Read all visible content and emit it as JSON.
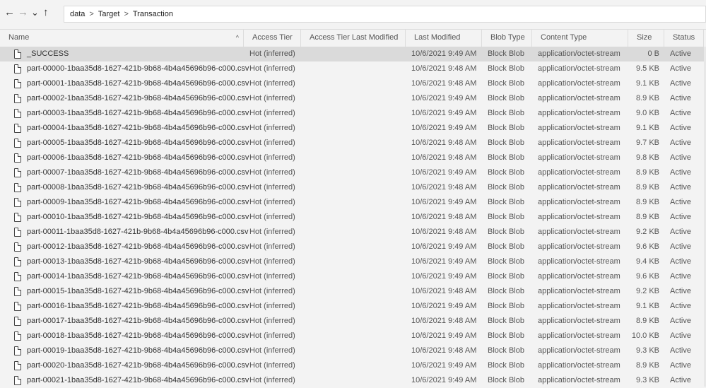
{
  "nav": {
    "back": "←",
    "forward": "→",
    "recent": "⌄",
    "up": "↑"
  },
  "breadcrumb": [
    "data",
    "Target",
    "Transaction"
  ],
  "columns": [
    "Name",
    "Access Tier",
    "Access Tier Last Modified",
    "Last Modified",
    "Blob Type",
    "Content Type",
    "Size",
    "Status"
  ],
  "sort_indicator": "^",
  "rows": [
    {
      "name": "_SUCCESS",
      "tier": "Hot (inferred)",
      "tlm": "",
      "modified": "10/6/2021 9:49 AM",
      "type": "Block Blob",
      "content": "application/octet-stream",
      "size": "0 B",
      "status": "Active"
    },
    {
      "name": "part-00000-1baa35d8-1627-421b-9b68-4b4a45696b96-c000.csv",
      "tier": "Hot (inferred)",
      "tlm": "",
      "modified": "10/6/2021 9:48 AM",
      "type": "Block Blob",
      "content": "application/octet-stream",
      "size": "9.5 KB",
      "status": "Active"
    },
    {
      "name": "part-00001-1baa35d8-1627-421b-9b68-4b4a45696b96-c000.csv",
      "tier": "Hot (inferred)",
      "tlm": "",
      "modified": "10/6/2021 9:48 AM",
      "type": "Block Blob",
      "content": "application/octet-stream",
      "size": "9.1 KB",
      "status": "Active"
    },
    {
      "name": "part-00002-1baa35d8-1627-421b-9b68-4b4a45696b96-c000.csv",
      "tier": "Hot (inferred)",
      "tlm": "",
      "modified": "10/6/2021 9:49 AM",
      "type": "Block Blob",
      "content": "application/octet-stream",
      "size": "8.9 KB",
      "status": "Active"
    },
    {
      "name": "part-00003-1baa35d8-1627-421b-9b68-4b4a45696b96-c000.csv",
      "tier": "Hot (inferred)",
      "tlm": "",
      "modified": "10/6/2021 9:49 AM",
      "type": "Block Blob",
      "content": "application/octet-stream",
      "size": "9.0 KB",
      "status": "Active"
    },
    {
      "name": "part-00004-1baa35d8-1627-421b-9b68-4b4a45696b96-c000.csv",
      "tier": "Hot (inferred)",
      "tlm": "",
      "modified": "10/6/2021 9:49 AM",
      "type": "Block Blob",
      "content": "application/octet-stream",
      "size": "9.1 KB",
      "status": "Active"
    },
    {
      "name": "part-00005-1baa35d8-1627-421b-9b68-4b4a45696b96-c000.csv",
      "tier": "Hot (inferred)",
      "tlm": "",
      "modified": "10/6/2021 9:48 AM",
      "type": "Block Blob",
      "content": "application/octet-stream",
      "size": "9.7 KB",
      "status": "Active"
    },
    {
      "name": "part-00006-1baa35d8-1627-421b-9b68-4b4a45696b96-c000.csv",
      "tier": "Hot (inferred)",
      "tlm": "",
      "modified": "10/6/2021 9:48 AM",
      "type": "Block Blob",
      "content": "application/octet-stream",
      "size": "9.8 KB",
      "status": "Active"
    },
    {
      "name": "part-00007-1baa35d8-1627-421b-9b68-4b4a45696b96-c000.csv",
      "tier": "Hot (inferred)",
      "tlm": "",
      "modified": "10/6/2021 9:49 AM",
      "type": "Block Blob",
      "content": "application/octet-stream",
      "size": "8.9 KB",
      "status": "Active"
    },
    {
      "name": "part-00008-1baa35d8-1627-421b-9b68-4b4a45696b96-c000.csv",
      "tier": "Hot (inferred)",
      "tlm": "",
      "modified": "10/6/2021 9:48 AM",
      "type": "Block Blob",
      "content": "application/octet-stream",
      "size": "8.9 KB",
      "status": "Active"
    },
    {
      "name": "part-00009-1baa35d8-1627-421b-9b68-4b4a45696b96-c000.csv",
      "tier": "Hot (inferred)",
      "tlm": "",
      "modified": "10/6/2021 9:49 AM",
      "type": "Block Blob",
      "content": "application/octet-stream",
      "size": "8.9 KB",
      "status": "Active"
    },
    {
      "name": "part-00010-1baa35d8-1627-421b-9b68-4b4a45696b96-c000.csv",
      "tier": "Hot (inferred)",
      "tlm": "",
      "modified": "10/6/2021 9:48 AM",
      "type": "Block Blob",
      "content": "application/octet-stream",
      "size": "8.9 KB",
      "status": "Active"
    },
    {
      "name": "part-00011-1baa35d8-1627-421b-9b68-4b4a45696b96-c000.csv",
      "tier": "Hot (inferred)",
      "tlm": "",
      "modified": "10/6/2021 9:48 AM",
      "type": "Block Blob",
      "content": "application/octet-stream",
      "size": "9.2 KB",
      "status": "Active"
    },
    {
      "name": "part-00012-1baa35d8-1627-421b-9b68-4b4a45696b96-c000.csv",
      "tier": "Hot (inferred)",
      "tlm": "",
      "modified": "10/6/2021 9:49 AM",
      "type": "Block Blob",
      "content": "application/octet-stream",
      "size": "9.6 KB",
      "status": "Active"
    },
    {
      "name": "part-00013-1baa35d8-1627-421b-9b68-4b4a45696b96-c000.csv",
      "tier": "Hot (inferred)",
      "tlm": "",
      "modified": "10/6/2021 9:49 AM",
      "type": "Block Blob",
      "content": "application/octet-stream",
      "size": "9.4 KB",
      "status": "Active"
    },
    {
      "name": "part-00014-1baa35d8-1627-421b-9b68-4b4a45696b96-c000.csv",
      "tier": "Hot (inferred)",
      "tlm": "",
      "modified": "10/6/2021 9:49 AM",
      "type": "Block Blob",
      "content": "application/octet-stream",
      "size": "9.6 KB",
      "status": "Active"
    },
    {
      "name": "part-00015-1baa35d8-1627-421b-9b68-4b4a45696b96-c000.csv",
      "tier": "Hot (inferred)",
      "tlm": "",
      "modified": "10/6/2021 9:48 AM",
      "type": "Block Blob",
      "content": "application/octet-stream",
      "size": "9.2 KB",
      "status": "Active"
    },
    {
      "name": "part-00016-1baa35d8-1627-421b-9b68-4b4a45696b96-c000.csv",
      "tier": "Hot (inferred)",
      "tlm": "",
      "modified": "10/6/2021 9:49 AM",
      "type": "Block Blob",
      "content": "application/octet-stream",
      "size": "9.1 KB",
      "status": "Active"
    },
    {
      "name": "part-00017-1baa35d8-1627-421b-9b68-4b4a45696b96-c000.csv",
      "tier": "Hot (inferred)",
      "tlm": "",
      "modified": "10/6/2021 9:48 AM",
      "type": "Block Blob",
      "content": "application/octet-stream",
      "size": "8.9 KB",
      "status": "Active"
    },
    {
      "name": "part-00018-1baa35d8-1627-421b-9b68-4b4a45696b96-c000.csv",
      "tier": "Hot (inferred)",
      "tlm": "",
      "modified": "10/6/2021 9:49 AM",
      "type": "Block Blob",
      "content": "application/octet-stream",
      "size": "10.0 KB",
      "status": "Active"
    },
    {
      "name": "part-00019-1baa35d8-1627-421b-9b68-4b4a45696b96-c000.csv",
      "tier": "Hot (inferred)",
      "tlm": "",
      "modified": "10/6/2021 9:48 AM",
      "type": "Block Blob",
      "content": "application/octet-stream",
      "size": "9.3 KB",
      "status": "Active"
    },
    {
      "name": "part-00020-1baa35d8-1627-421b-9b68-4b4a45696b96-c000.csv",
      "tier": "Hot (inferred)",
      "tlm": "",
      "modified": "10/6/2021 9:49 AM",
      "type": "Block Blob",
      "content": "application/octet-stream",
      "size": "8.9 KB",
      "status": "Active"
    },
    {
      "name": "part-00021-1baa35d8-1627-421b-9b68-4b4a45696b96-c000.csv",
      "tier": "Hot (inferred)",
      "tlm": "",
      "modified": "10/6/2021 9:49 AM",
      "type": "Block Blob",
      "content": "application/octet-stream",
      "size": "9.3 KB",
      "status": "Active"
    }
  ],
  "selected_row": 0
}
